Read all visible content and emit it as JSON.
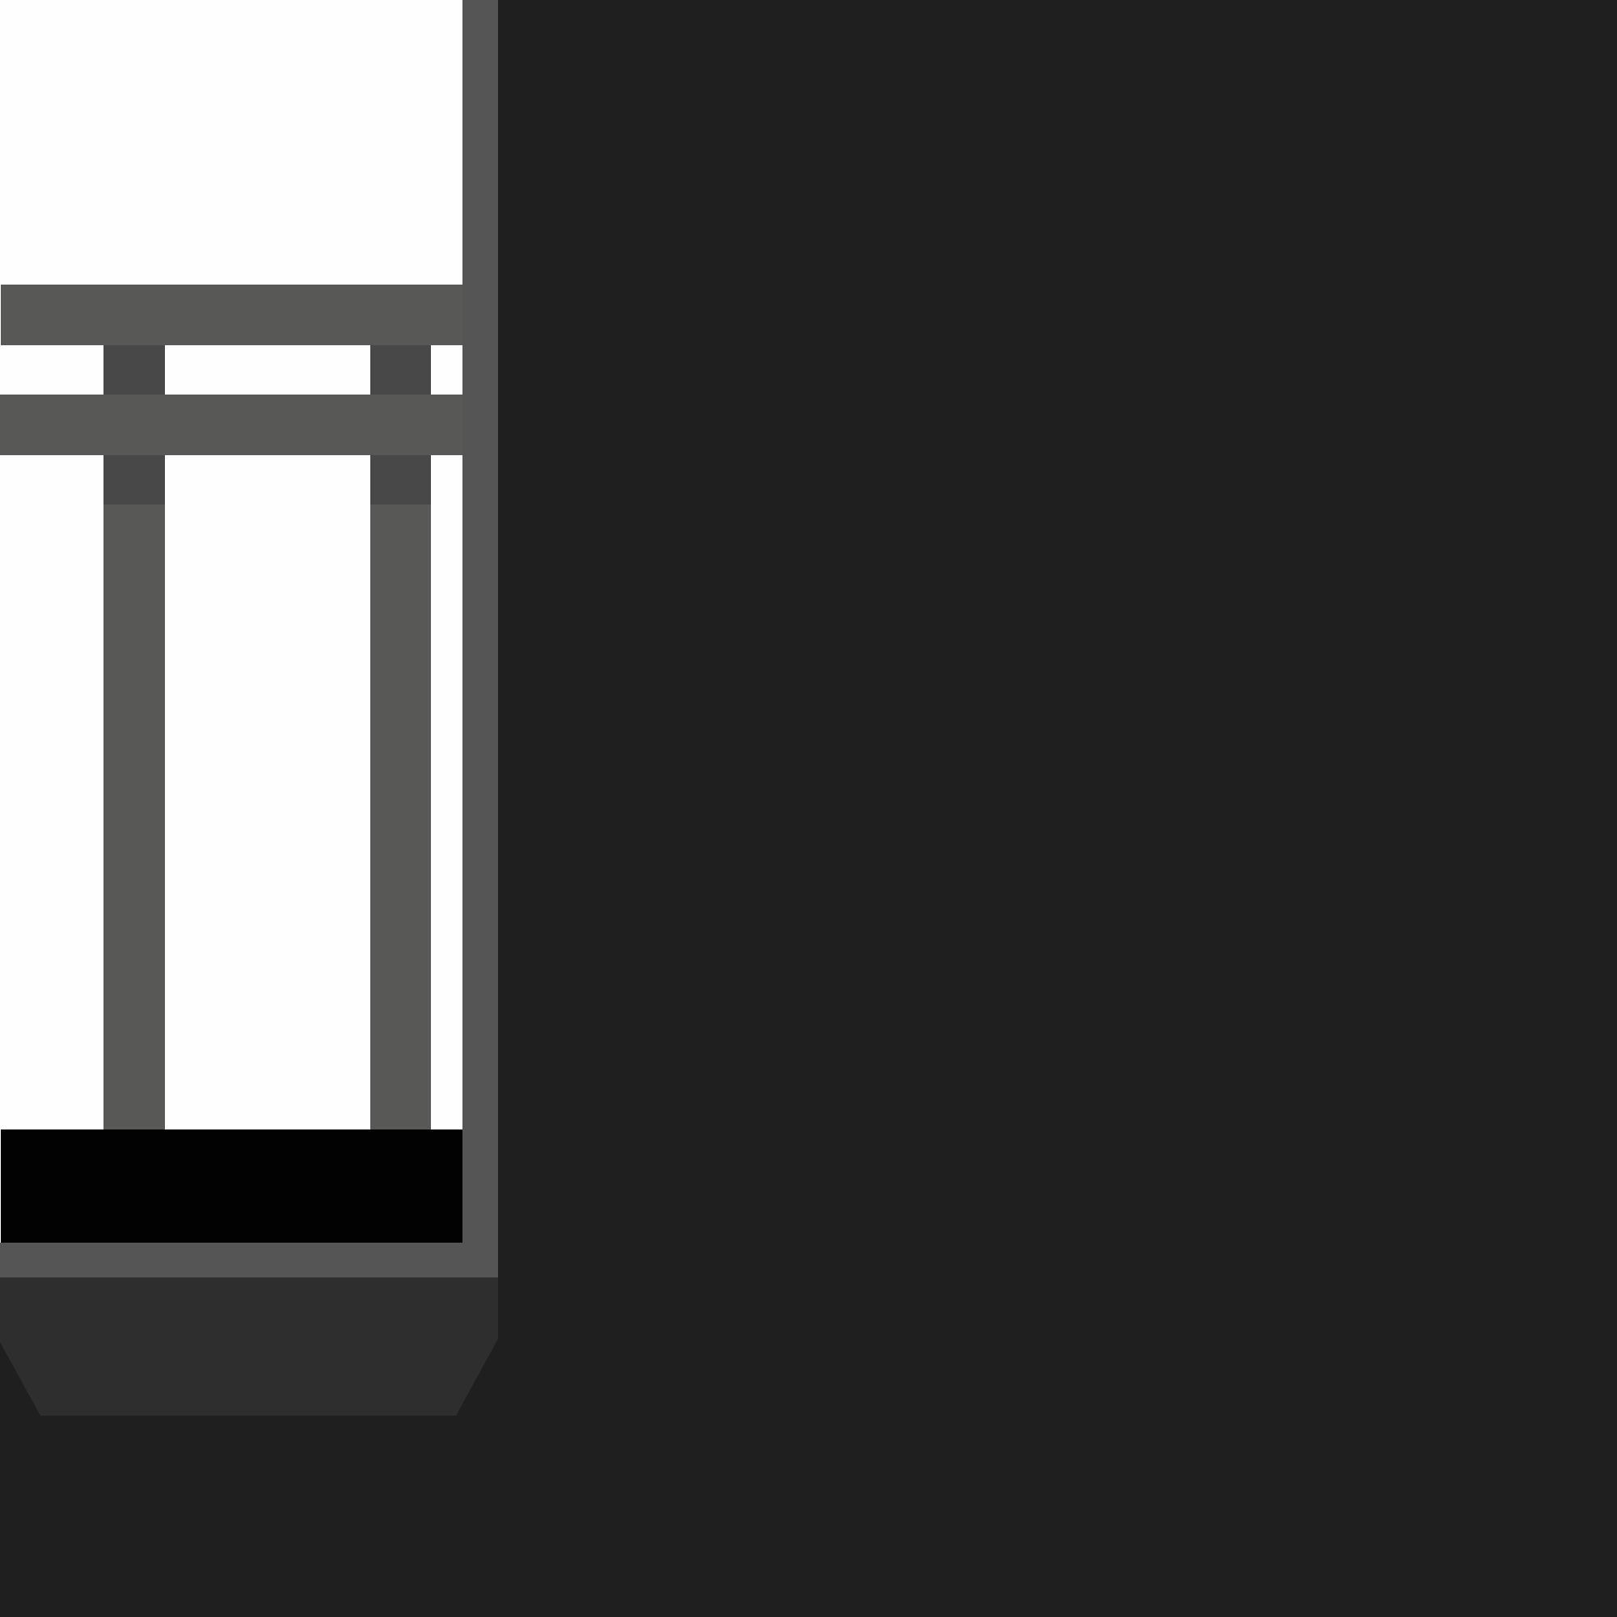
{
  "colors": {
    "background": "#1e1f1e",
    "window_light": "#fefefe",
    "frame": "#585856",
    "frame_edge": "#555555",
    "crossbar_shadow": "#484848",
    "sill_block": "#020202",
    "base": "#2e2e2e"
  }
}
